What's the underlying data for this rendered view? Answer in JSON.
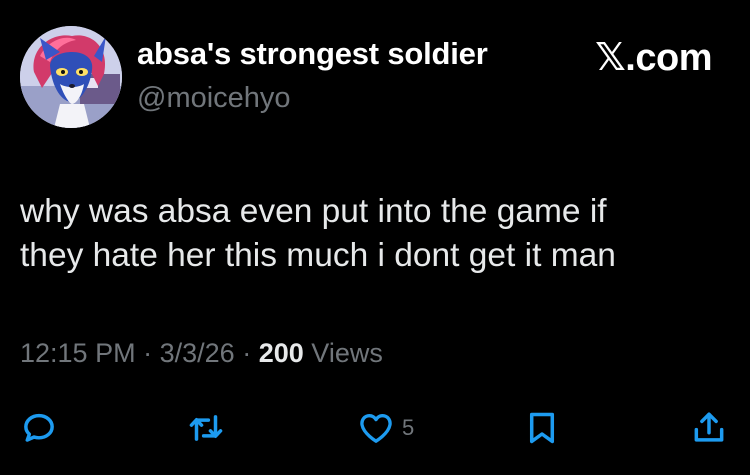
{
  "author": {
    "display_name": "absa's strongest soldier",
    "handle": "@moicehyo",
    "avatar_icon": "fox-character-avatar"
  },
  "brand": {
    "glyph": "𝕏",
    "suffix": ".com"
  },
  "tweet": {
    "lines": [
      "why was absa even put into the game if",
      "they hate her this much i dont get it man"
    ]
  },
  "meta": {
    "time": "12:15 PM",
    "separator": "·",
    "date": "3/3/26",
    "views_count": "200",
    "views_label": "Views"
  },
  "actions": {
    "reply_icon": "reply-icon",
    "retweet_icon": "retweet-icon",
    "like_icon": "heart-icon",
    "like_count": "5",
    "bookmark_icon": "bookmark-icon",
    "share_icon": "share-icon"
  },
  "colors": {
    "background": "#000000",
    "text": "#e7e9ea",
    "secondary": "#71767b"
  }
}
